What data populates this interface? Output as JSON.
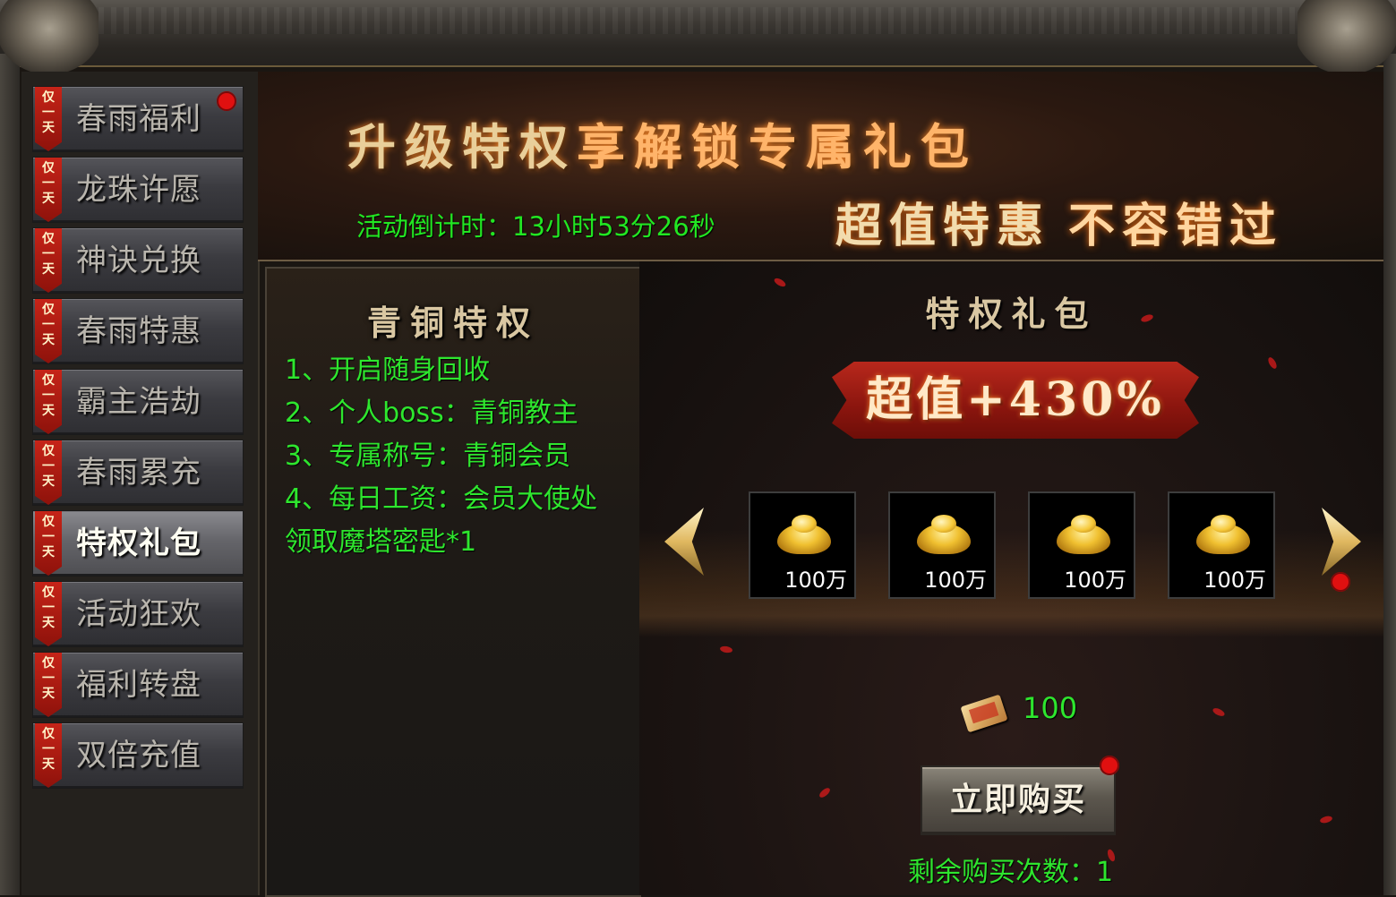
{
  "sidebar": {
    "items": [
      {
        "tag": "仅\n一\n天",
        "label": "春雨福利",
        "active": false
      },
      {
        "tag": "仅\n一\n天",
        "label": "龙珠许愿",
        "active": false
      },
      {
        "tag": "仅\n一\n天",
        "label": "神诀兑换",
        "active": false
      },
      {
        "tag": "仅\n一\n天",
        "label": "春雨特惠",
        "active": false
      },
      {
        "tag": "仅\n一\n天",
        "label": "霸主浩劫",
        "active": false
      },
      {
        "tag": "仅\n一\n天",
        "label": "春雨累充",
        "active": false
      },
      {
        "tag": "仅\n一\n天",
        "label": "特权礼包",
        "active": true
      },
      {
        "tag": "仅\n一\n天",
        "label": "活动狂欢",
        "active": false
      },
      {
        "tag": "仅\n一\n天",
        "label": "福利转盘",
        "active": false
      },
      {
        "tag": "仅\n一\n天",
        "label": "双倍充值",
        "active": false
      }
    ]
  },
  "banner": {
    "title_a": "升级特权",
    "title_b": "享解锁专属礼包",
    "countdown": "活动倒计时：13小时53分26秒",
    "slogan_a": "超值特惠",
    "slogan_b": "不容错过"
  },
  "privilege": {
    "title": "青铜特权",
    "perks": [
      "1、开启随身回收",
      "2、个人boss：青铜教主",
      "3、专属称号：青铜会员",
      "4、每日工资：会员大使处",
      "领取魔塔密匙*1"
    ]
  },
  "gift": {
    "title": "特权礼包",
    "bonus": "超值+430%",
    "items": [
      {
        "icon": "gold-ingot-icon",
        "amount": "100万"
      },
      {
        "icon": "gold-ingot-icon",
        "amount": "100万"
      },
      {
        "icon": "gold-ingot-icon",
        "amount": "100万"
      },
      {
        "icon": "gold-ingot-icon",
        "amount": "100万"
      }
    ],
    "price": "100",
    "price_icon": "voucher-icon",
    "buy_label": "立即购买",
    "remaining": "剩余购买次数：1"
  },
  "colors": {
    "accent_green": "#2ee62e",
    "notify_red": "#e01010",
    "tag_red": "#c62418"
  }
}
